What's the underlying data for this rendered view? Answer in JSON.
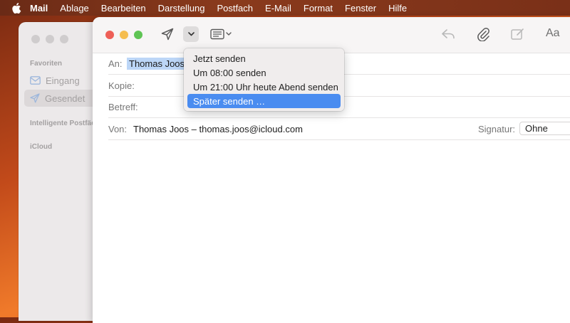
{
  "menubar": {
    "items": [
      "Mail",
      "Ablage",
      "Bearbeiten",
      "Darstellung",
      "Postfach",
      "E-Mail",
      "Format",
      "Fenster",
      "Hilfe"
    ]
  },
  "sidebar": {
    "favorites_header": "Favoriten",
    "items": [
      {
        "label": "Eingang",
        "icon": "inbox-icon"
      },
      {
        "label": "Gesendet",
        "icon": "paperplane-icon"
      }
    ],
    "smart_header": "Intelligente Postfächer",
    "icloud_header": "iCloud"
  },
  "compose": {
    "to_label": "An:",
    "to_value": "Thomas Joos",
    "cc_label": "Kopie:",
    "subject_label": "Betreff:",
    "from_label": "Von:",
    "from_value": "Thomas Joos – thomas.joos@icloud.com",
    "signature_label": "Signatur:",
    "signature_value": "Ohne",
    "format_label": "Aa"
  },
  "send_menu": {
    "items": [
      "Jetzt senden",
      "Um 08:00 senden",
      "Um 21:00 Uhr heute Abend senden",
      "Später senden …"
    ],
    "highlighted_index": 3
  },
  "colors": {
    "highlight": "#4a8cf0",
    "token": "#bcd6f7",
    "close": "#ee5f57",
    "minimize": "#f5bd4f",
    "zoom": "#5fc454"
  }
}
